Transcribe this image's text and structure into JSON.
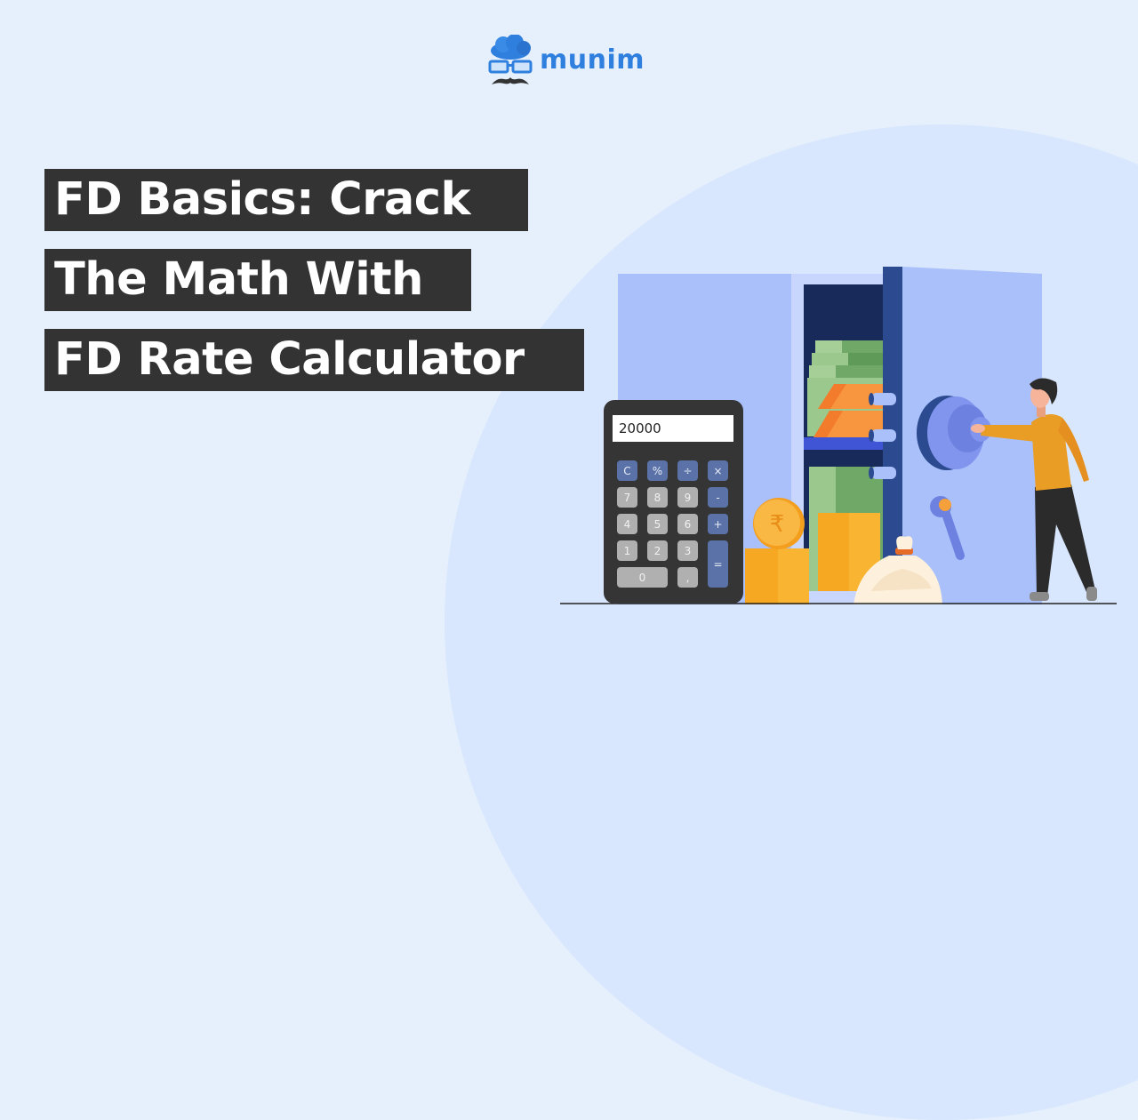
{
  "brand": {
    "name": "munim",
    "logo_icon": "cloud-glasses-mustache-icon",
    "color": "#2f7fdf"
  },
  "title": {
    "lines": [
      "FD Basics: Crack",
      "The Math With",
      "FD Rate Calculator"
    ],
    "text_color": "#ffffff",
    "highlight_color": "#333333"
  },
  "illustration": {
    "calculator": {
      "display": "20000",
      "keys": [
        {
          "label": "C",
          "type": "op"
        },
        {
          "label": "%",
          "type": "op"
        },
        {
          "label": "÷",
          "type": "op"
        },
        {
          "label": "×",
          "type": "op"
        },
        {
          "label": "7",
          "type": "num"
        },
        {
          "label": "8",
          "type": "num"
        },
        {
          "label": "9",
          "type": "num"
        },
        {
          "label": "-",
          "type": "op"
        },
        {
          "label": "4",
          "type": "num"
        },
        {
          "label": "5",
          "type": "num"
        },
        {
          "label": "6",
          "type": "num"
        },
        {
          "label": "+",
          "type": "op"
        },
        {
          "label": "1",
          "type": "num"
        },
        {
          "label": "2",
          "type": "num"
        },
        {
          "label": "3",
          "type": "num"
        },
        {
          "label": "=",
          "type": "op"
        },
        {
          "label": "0",
          "type": "num"
        },
        {
          "label": ",",
          "type": "num"
        }
      ]
    },
    "coin_symbol": "₹",
    "elements": [
      "safe",
      "cash-stacks",
      "gold-bars",
      "coin-stacks",
      "money-bag",
      "person-opening-safe"
    ]
  },
  "colors": {
    "background": "#e6f0fd",
    "circle": "#d8e7fd",
    "safe": "#aac0fa",
    "safe_dark": "#2c4a8f",
    "coin": "#f7a823",
    "person_shirt": "#e99d25"
  }
}
